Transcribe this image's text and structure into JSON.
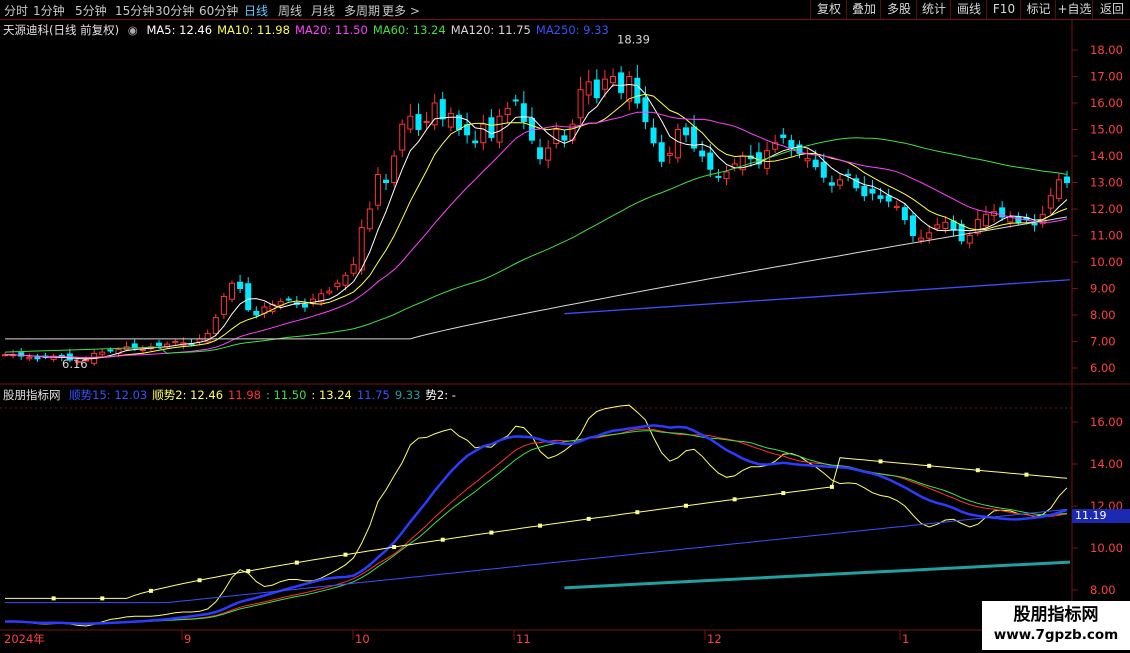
{
  "toolbar": {
    "periods": [
      "分时",
      "1分钟",
      "5分钟",
      "15分钟",
      "30分钟",
      "60分钟",
      "日线",
      "周线",
      "月线",
      "多周期",
      "更多 >"
    ],
    "active_period": "日线",
    "buttons": [
      "复权",
      "叠加",
      "多股",
      "统计",
      "画线",
      "F10",
      "标记",
      "+自选",
      "返回"
    ]
  },
  "main_legend": {
    "title": "天源迪科(日线 前复权)",
    "items": [
      {
        "label": "MA5: 12.46",
        "color": "#ffffff"
      },
      {
        "label": "MA10: 11.98",
        "color": "#ffff40"
      },
      {
        "label": "MA20: 11.50",
        "color": "#ff40ff"
      },
      {
        "label": "MA60: 13.24",
        "color": "#40e040"
      },
      {
        "label": "MA120: 11.75",
        "color": "#d8d8d8"
      },
      {
        "label": "MA250: 9.33",
        "color": "#3a50ff"
      }
    ]
  },
  "sub_legend": {
    "title": "股朋指标网",
    "items": [
      {
        "label": "顺势15: 12.03",
        "color": "#3a50ff"
      },
      {
        "label": "顺势2: 12.46",
        "color": "#ffff60"
      },
      {
        "label": "11.98",
        "color": "#ff3030"
      },
      {
        "label": ": 11.50",
        "color": "#40e040"
      },
      {
        "label": ": 13.24",
        "color": "#ffff60"
      },
      {
        "label": "11.75",
        "color": "#3a50ff"
      },
      {
        "label": "9.33",
        "color": "#20a0a0"
      },
      {
        "label": "势2: -",
        "color": "#ffffff"
      }
    ]
  },
  "main_axis": [
    "18.00",
    "17.00",
    "16.00",
    "15.00",
    "14.00",
    "13.00",
    "12.00",
    "11.00",
    "10.00",
    "9.00",
    "8.00",
    "7.00",
    "6.00"
  ],
  "sub_axis": [
    "16.00",
    "14.00",
    "12.00",
    "10.00",
    "8.00"
  ],
  "x_axis": {
    "year": "2024年",
    "months": [
      "9",
      "10",
      "11",
      "12",
      "1"
    ]
  },
  "annotations": {
    "high": "18.39",
    "low": "6.16"
  },
  "last_value": "11.19",
  "watermark": {
    "title": "股朋指标网",
    "url": "www.7gpzb.com"
  },
  "colors": {
    "up": "#ff3232",
    "down": "#00e8ff",
    "ma5": "#ffffff",
    "ma10": "#ffff40",
    "ma20": "#ff40ff",
    "ma60": "#40e040",
    "ma120": "#d8d8d8",
    "ma250": "#3a50ff",
    "grid": "#7a1010"
  }
}
